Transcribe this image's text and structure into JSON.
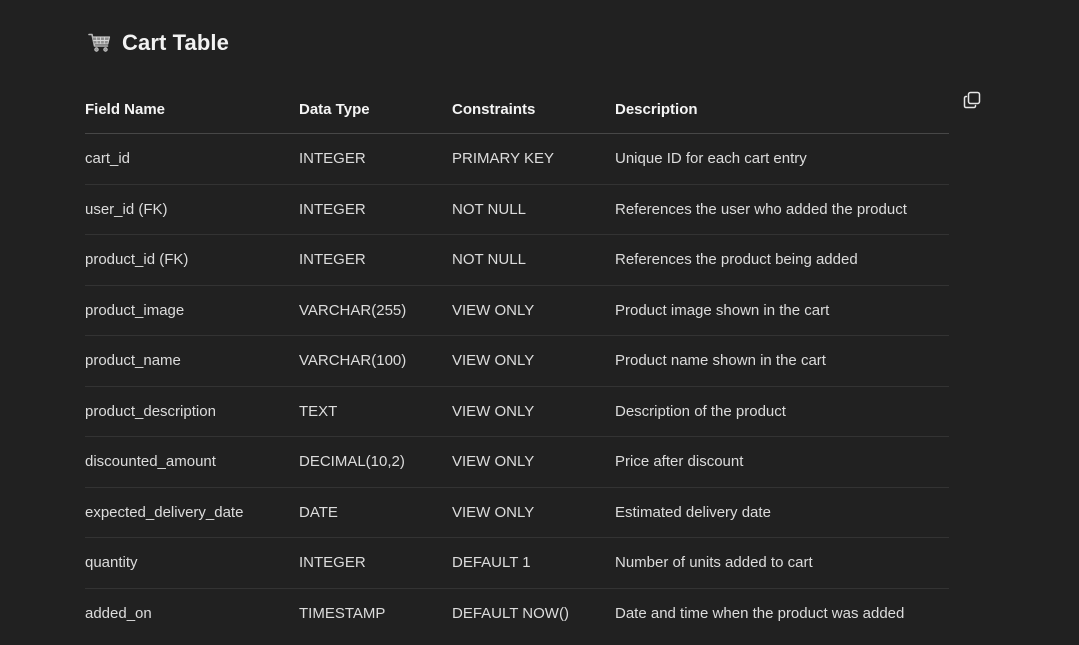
{
  "heading": {
    "icon": "shopping-cart-icon",
    "title": "Cart Table"
  },
  "copy_button": {
    "icon": "copy-icon"
  },
  "table": {
    "headers": [
      "Field Name",
      "Data Type",
      "Constraints",
      "Description"
    ],
    "rows": [
      [
        "cart_id",
        "INTEGER",
        "PRIMARY KEY",
        "Unique ID for each cart entry"
      ],
      [
        "user_id (FK)",
        "INTEGER",
        "NOT NULL",
        "References the user who added the product"
      ],
      [
        "product_id (FK)",
        "INTEGER",
        "NOT NULL",
        "References the product being added"
      ],
      [
        "product_image",
        "VARCHAR(255)",
        "VIEW ONLY",
        "Product image shown in the cart"
      ],
      [
        "product_name",
        "VARCHAR(100)",
        "VIEW ONLY",
        "Product name shown in the cart"
      ],
      [
        "product_description",
        "TEXT",
        "VIEW ONLY",
        "Description of the product"
      ],
      [
        "discounted_amount",
        "DECIMAL(10,2)",
        "VIEW ONLY",
        "Price after discount"
      ],
      [
        "expected_delivery_date",
        "DATE",
        "VIEW ONLY",
        "Estimated delivery date"
      ],
      [
        "quantity",
        "INTEGER",
        "DEFAULT 1",
        "Number of units added to cart"
      ],
      [
        "added_on",
        "TIMESTAMP",
        "DEFAULT NOW()",
        "Date and time when the product was added"
      ]
    ]
  }
}
